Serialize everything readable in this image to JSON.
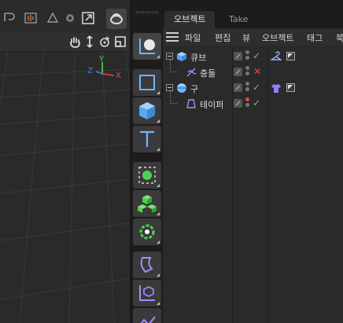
{
  "object_manager": {
    "tabs": [
      "오브젝트",
      "Take"
    ],
    "menu": [
      "파일",
      "편집",
      "뷰",
      "오브젝트",
      "태그",
      "북"
    ],
    "objects": [
      {
        "name": "큐브",
        "icon": "cube-icon",
        "expanded": true,
        "enabled": true,
        "tag": "hanger-tag-icon"
      },
      {
        "name": "충돌",
        "icon": "collision-deformer-icon",
        "enabled": false
      },
      {
        "name": "구",
        "icon": "sphere-icon",
        "expanded": true,
        "enabled": true,
        "tag": "shirt-tag-icon"
      },
      {
        "name": "테이퍼",
        "icon": "taper-deformer-icon",
        "enabled": true
      }
    ]
  },
  "viewport": {
    "axes": {
      "x": "X",
      "y": "Y",
      "z": "Z"
    },
    "toolbar_icons": [
      "undo-icon",
      "timeline-icon",
      "recycle-icon",
      "gear-icon",
      "export-icon",
      "torus-icon"
    ],
    "nav_icons": [
      "hand-pan-icon",
      "move-arrows-icon",
      "rotate-icon",
      "maximize-icon"
    ]
  },
  "palette": {
    "tools": [
      "null-object-icon",
      "plane-icon",
      "cube-icon",
      "text-icon",
      "cloner-sphere-icon",
      "cloner-cubes-icon",
      "effector-icon",
      "deformer-bend-icon",
      "generator-icon",
      "spline-icon"
    ]
  },
  "colors": {
    "check": "#5fcf4a",
    "cross": "#e04848",
    "object_icon": "#6fb6ff",
    "deformer_icon": "#a78bff",
    "green_tool": "#4fd24f"
  }
}
